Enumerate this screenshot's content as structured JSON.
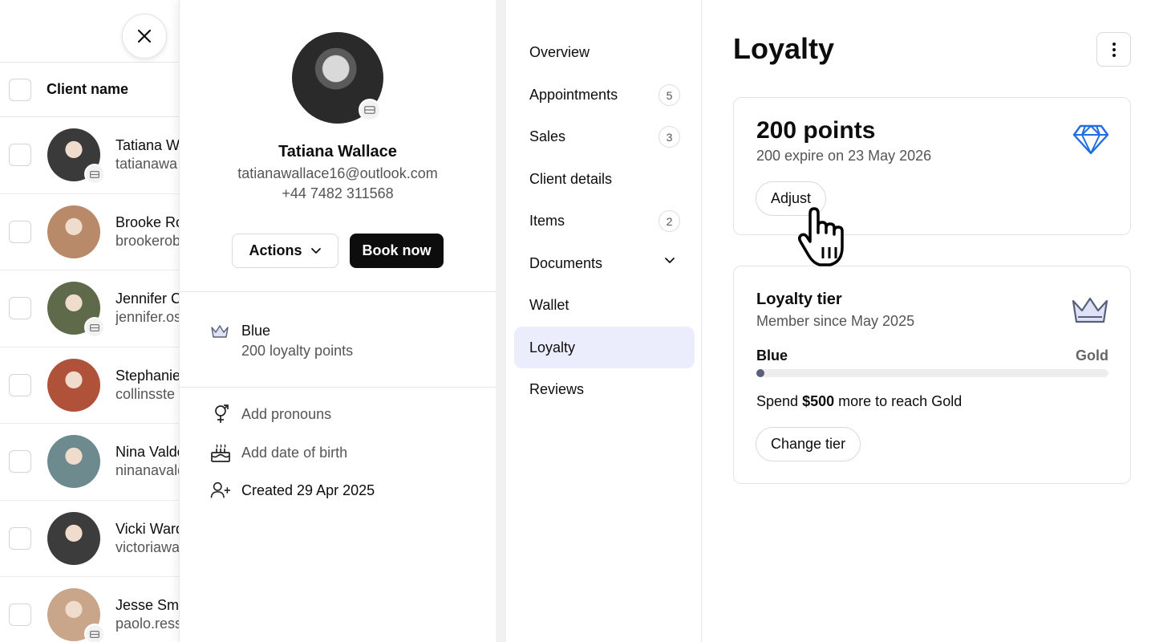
{
  "list": {
    "header": "Client name",
    "rows": [
      {
        "name": "Tatiana W",
        "email": "tatianawa",
        "badge": true,
        "tone": "#3a3a3a"
      },
      {
        "name": "Brooke Ro",
        "email": "brookerob",
        "badge": false,
        "tone": "#b98a6a"
      },
      {
        "name": "Jennifer C",
        "email": "jennifer.os",
        "badge": true,
        "tone": "#5e6a4a"
      },
      {
        "name": "Stephanie",
        "email": "collinsste",
        "badge": false,
        "tone": "#b0513a"
      },
      {
        "name": "Nina Valde",
        "email": "ninanavald",
        "badge": false,
        "tone": "#6d8a8f"
      },
      {
        "name": "Vicki Ward",
        "email": "victoriawa",
        "badge": false,
        "tone": "#3c3c3c"
      },
      {
        "name": "Jesse Smit",
        "email": "paolo.ress",
        "badge": true,
        "tone": "#c9a58a"
      }
    ]
  },
  "profile": {
    "name": "Tatiana Wallace",
    "email": "tatianawallace16@outlook.com",
    "phone": "+44 7482 311568",
    "actions_label": "Actions",
    "book_label": "Book now",
    "tier_name": "Blue",
    "tier_points": "200 loyalty points",
    "add_pronouns": "Add pronouns",
    "add_dob": "Add date of birth",
    "created": "Created 29 Apr 2025"
  },
  "nav": {
    "overview": "Overview",
    "appointments": "Appointments",
    "appointments_count": "5",
    "sales": "Sales",
    "sales_count": "3",
    "client_details": "Client details",
    "items": "Items",
    "items_count": "2",
    "documents": "Documents",
    "wallet": "Wallet",
    "loyalty": "Loyalty",
    "reviews": "Reviews"
  },
  "main": {
    "title": "Loyalty",
    "points_title": "200 points",
    "points_expiry": "200 expire on 23 May 2026",
    "adjust_label": "Adjust",
    "tier_title": "Loyalty tier",
    "tier_since": "Member since May 2025",
    "tier_from": "Blue",
    "tier_to": "Gold",
    "tier_progress": 0.0,
    "spend_prefix": "Spend",
    "spend_amount": "$500",
    "spend_suffix": "more to reach Gold",
    "change_tier_label": "Change tier"
  },
  "colors": {
    "active_nav": "#ebedfc",
    "gem": "#1f6fe0",
    "crown": "#5a5f77",
    "primary_button": "#0d0d0d"
  }
}
